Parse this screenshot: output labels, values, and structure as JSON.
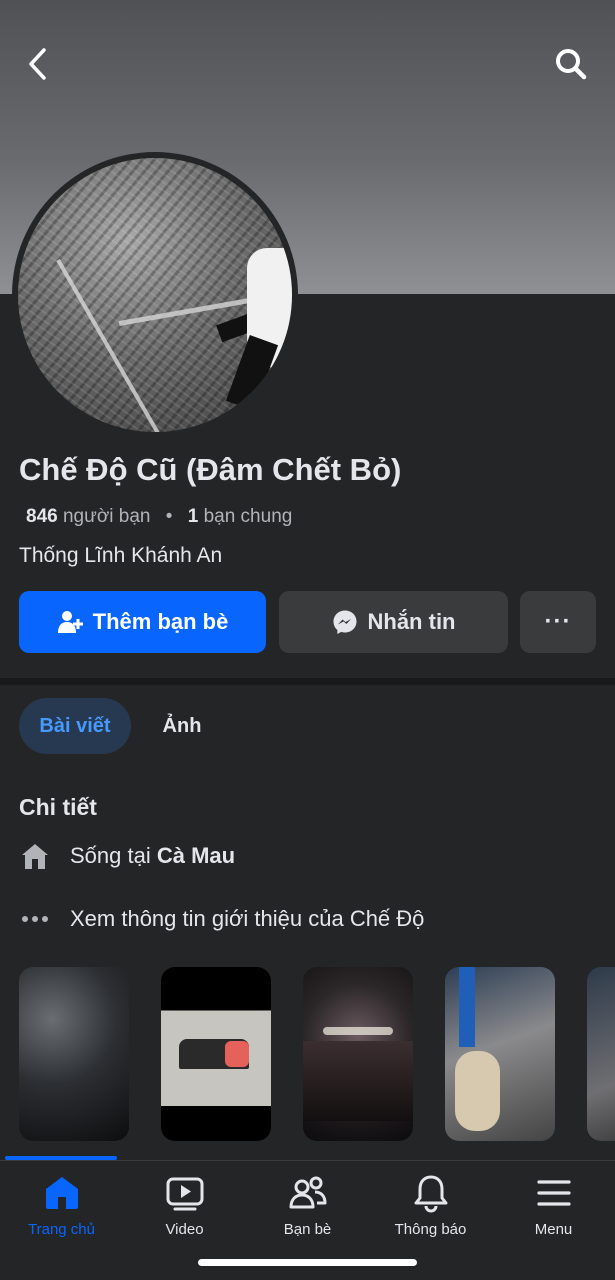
{
  "header": {
    "back_icon": "chevron-left-icon",
    "search_icon": "search-icon"
  },
  "profile": {
    "name": "Chế Độ Cũ (Đâm Chết Bỏ)",
    "friend_count": "846",
    "friend_label": "người bạn",
    "separator": "•",
    "mutual_count": "1",
    "mutual_label": "bạn chung",
    "work": "Thống Lĩnh Khánh An"
  },
  "actions": {
    "add_friend_label": "Thêm bạn bè",
    "message_label": "Nhắn tin",
    "more_label": "···",
    "accent_color": "#0866ff"
  },
  "tabs": [
    {
      "label": "Bài viết",
      "active": true
    },
    {
      "label": "Ảnh",
      "active": false
    }
  ],
  "details": {
    "title": "Chi tiết",
    "lives_prefix": "Sống tại ",
    "lives_city": "Cà Mau",
    "intro_link": "Xem thông tin giới thiệu của Chế Độ"
  },
  "bottom_nav": [
    {
      "label": "Trang chủ",
      "icon": "home-icon",
      "active": true
    },
    {
      "label": "Video",
      "icon": "video-icon",
      "active": false
    },
    {
      "label": "Bạn bè",
      "icon": "friends-icon",
      "active": false
    },
    {
      "label": "Thông báo",
      "icon": "bell-icon",
      "active": false
    },
    {
      "label": "Menu",
      "icon": "menu-icon",
      "active": false
    }
  ]
}
